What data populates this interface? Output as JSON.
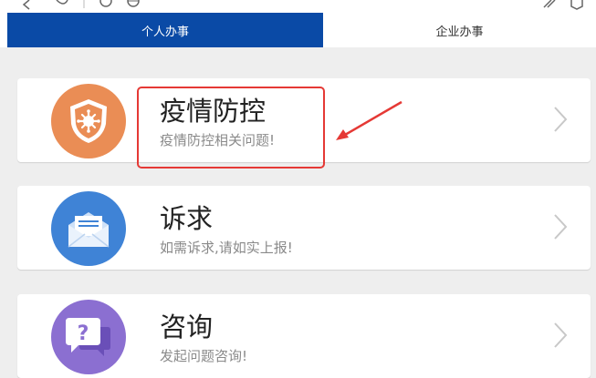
{
  "tabs": [
    {
      "label": "个人办事",
      "active": true
    },
    {
      "label": "企业办事",
      "active": false
    }
  ],
  "cards": [
    {
      "title": "疫情防控",
      "subtitle": "疫情防控相关问题!",
      "icon": "virus-shield-icon",
      "color": "#ea8d55"
    },
    {
      "title": "诉求",
      "subtitle": "如需诉求,请如实上报!",
      "icon": "envelope-icon",
      "color": "#3f83d6"
    },
    {
      "title": "咨询",
      "subtitle": "发起问题咨询!",
      "icon": "question-chat-icon",
      "color": "#8b6fd1"
    }
  ],
  "colors": {
    "tab_active_bg": "#0a4aa6",
    "annotation": "#e53935"
  }
}
